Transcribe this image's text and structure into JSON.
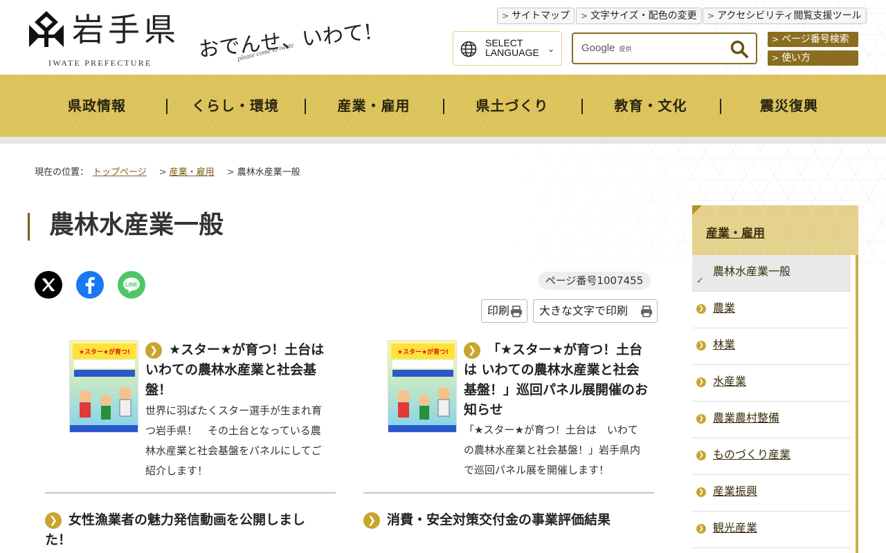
{
  "header": {
    "logo_title": "岩手県",
    "logo_sub": "IWATE PREFECTURE",
    "slogan": "おでんせ、いわて!",
    "slogan_en": "please come to iwate",
    "util_links": [
      "サイトマップ",
      "文字サイズ・配色の変更",
      "アクセシビリティ閲覧支援ツール"
    ],
    "language_line1": "SELECT",
    "language_line2": "LANGUAGE",
    "search_brand": "Google",
    "search_brand_sub": "提供",
    "search_placeholder": "",
    "page_number_search": "ページ番号検索",
    "how_to_use": "使い方"
  },
  "nav": [
    "県政情報",
    "くらし・環境",
    "産業・雇用",
    "県土づくり",
    "教育・文化",
    "震災復興"
  ],
  "breadcrumb": {
    "prefix": "現在の位置：",
    "items": [
      "トップページ",
      "産業・雇用"
    ],
    "current": "農林水産業一般"
  },
  "page": {
    "title": "農林水産業一般",
    "page_id": "ページ番号1007455",
    "print": "印刷",
    "print_large": "大きな文字で印刷"
  },
  "cards": [
    {
      "title": "★スター★が育つ！土台は いわての農林水産業と社会基盤！",
      "desc": "世界に羽ばたくスター選手が生まれ育つ岩手県！　その土台となっている農林水産業と社会基盤をパネルにしてご紹介します！",
      "thumb_text": "★スター★が育つ！土台は いわての農林水産業と社会基盤！"
    },
    {
      "title": "「★スター★が育つ！土台は いわての農林水産業と社会基盤！」巡回パネル展開催のお知らせ",
      "desc": "「★スター★が育つ！土台は　いわての農林水産業と社会基盤！」岩手県内で巡回パネル展を開催します！",
      "thumb_text": "★スター★が育つ！土台は いわての農林水産業と社会基盤！"
    }
  ],
  "links": [
    {
      "title": "女性漁業者の魅力発信動画を公開しました！"
    },
    {
      "title": "消費・安全対策交付金の事業評価結果"
    }
  ],
  "sidebar": {
    "heading": "産業・雇用",
    "items": [
      "農林水産業一般",
      "農業",
      "林業",
      "水産業",
      "農業農村整備",
      "ものづくり産業",
      "産業振興",
      "観光産業"
    ]
  },
  "colors": {
    "gold": "#dcc35c",
    "brown": "#8a6d1e"
  }
}
